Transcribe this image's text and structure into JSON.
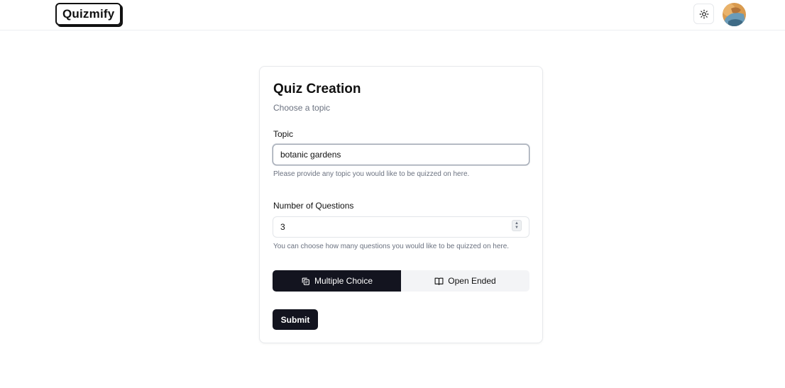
{
  "navbar": {
    "logo": "Quizmify",
    "theme_toggle_icon": "sun-icon",
    "avatar_icon": "user-avatar"
  },
  "card": {
    "title": "Quiz Creation",
    "description": "Choose a topic",
    "topic": {
      "label": "Topic",
      "value": "botanic gardens",
      "hint": "Please provide any topic you would like to be quizzed on here."
    },
    "questions": {
      "label": "Number of Questions",
      "value": "3",
      "hint": "You can choose how many questions you would like to be quizzed on here."
    },
    "quiz_type": {
      "options": [
        {
          "label": "Multiple Choice",
          "icon": "copy-icon",
          "selected": true
        },
        {
          "label": "Open Ended",
          "icon": "book-open-icon",
          "selected": false
        }
      ]
    },
    "submit_label": "Submit"
  },
  "colors": {
    "primary": "#13141f",
    "muted_text": "#6b7280",
    "secondary_bg": "#f3f4f6",
    "border": "#e2e5e9"
  }
}
